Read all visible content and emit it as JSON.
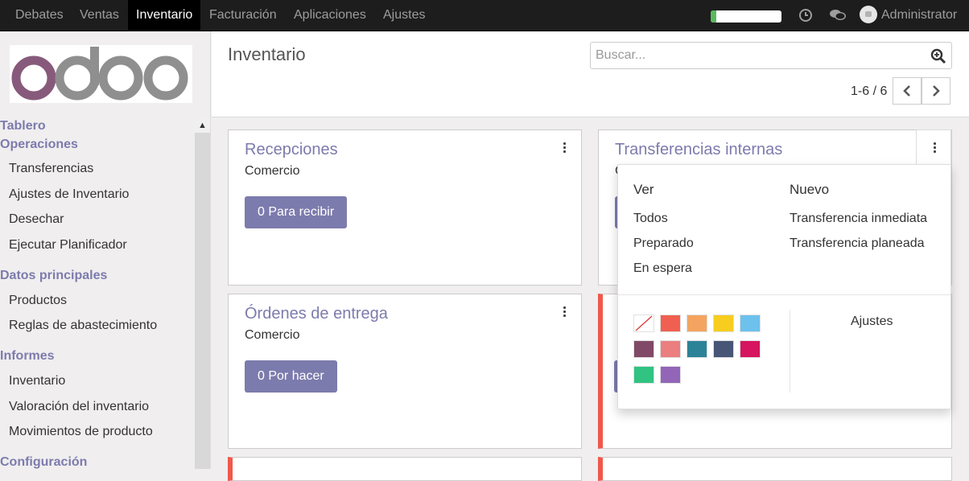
{
  "navbar": {
    "items": [
      "Debates",
      "Ventas",
      "Inventario",
      "Facturación",
      "Aplicaciones",
      "Ajustes"
    ],
    "active_index": 2,
    "progress_fraction": 0.08,
    "progress_color": "#5cb85c",
    "icons": [
      "clock-icon",
      "chat-icon"
    ],
    "user_name": "Administrator"
  },
  "sidebar": {
    "sections": [
      {
        "title": "Tablero",
        "items": []
      },
      {
        "title": "Operaciones",
        "items": [
          "Transferencias",
          "Ajustes de Inventario",
          "Desechar",
          "Ejecutar Planificador"
        ]
      },
      {
        "title": "Datos principales",
        "items": [
          "Productos",
          "Reglas de abastecimiento"
        ]
      },
      {
        "title": "Informes",
        "items": [
          "Inventario",
          "Valoración del inventario",
          "Movimientos de producto"
        ]
      },
      {
        "title": "Configuración",
        "items": []
      }
    ]
  },
  "control_panel": {
    "title": "Inventario",
    "search_placeholder": "Buscar...",
    "pager": "1-6 / 6"
  },
  "cards": [
    {
      "title": "Recepciones",
      "subtitle": "Comercio",
      "button": "0 Para recibir"
    },
    {
      "title": "Transferencias internas",
      "subtitle": "",
      "button": ""
    },
    {
      "title": "Órdenes de entrega",
      "subtitle": "Comercio",
      "button": "0 Por hacer"
    }
  ],
  "dropdown": {
    "view_header": "Ver",
    "new_header": "Nuevo",
    "view_items": [
      "Todos",
      "Preparado",
      "En espera"
    ],
    "new_items": [
      "Transferencia inmediata",
      "Transferencia planeada"
    ],
    "settings_label": "Ajustes",
    "colors": [
      "#f06050",
      "#f4a460",
      "#f7cd1f",
      "#6cc1ed",
      "#814968",
      "#eb7e7f",
      "#2c8397",
      "#475577",
      "#d6145f",
      "#30c381",
      "#9365b8"
    ]
  },
  "colors": {
    "accent": "#7c7bad",
    "card_border_red": "#f0584a"
  }
}
